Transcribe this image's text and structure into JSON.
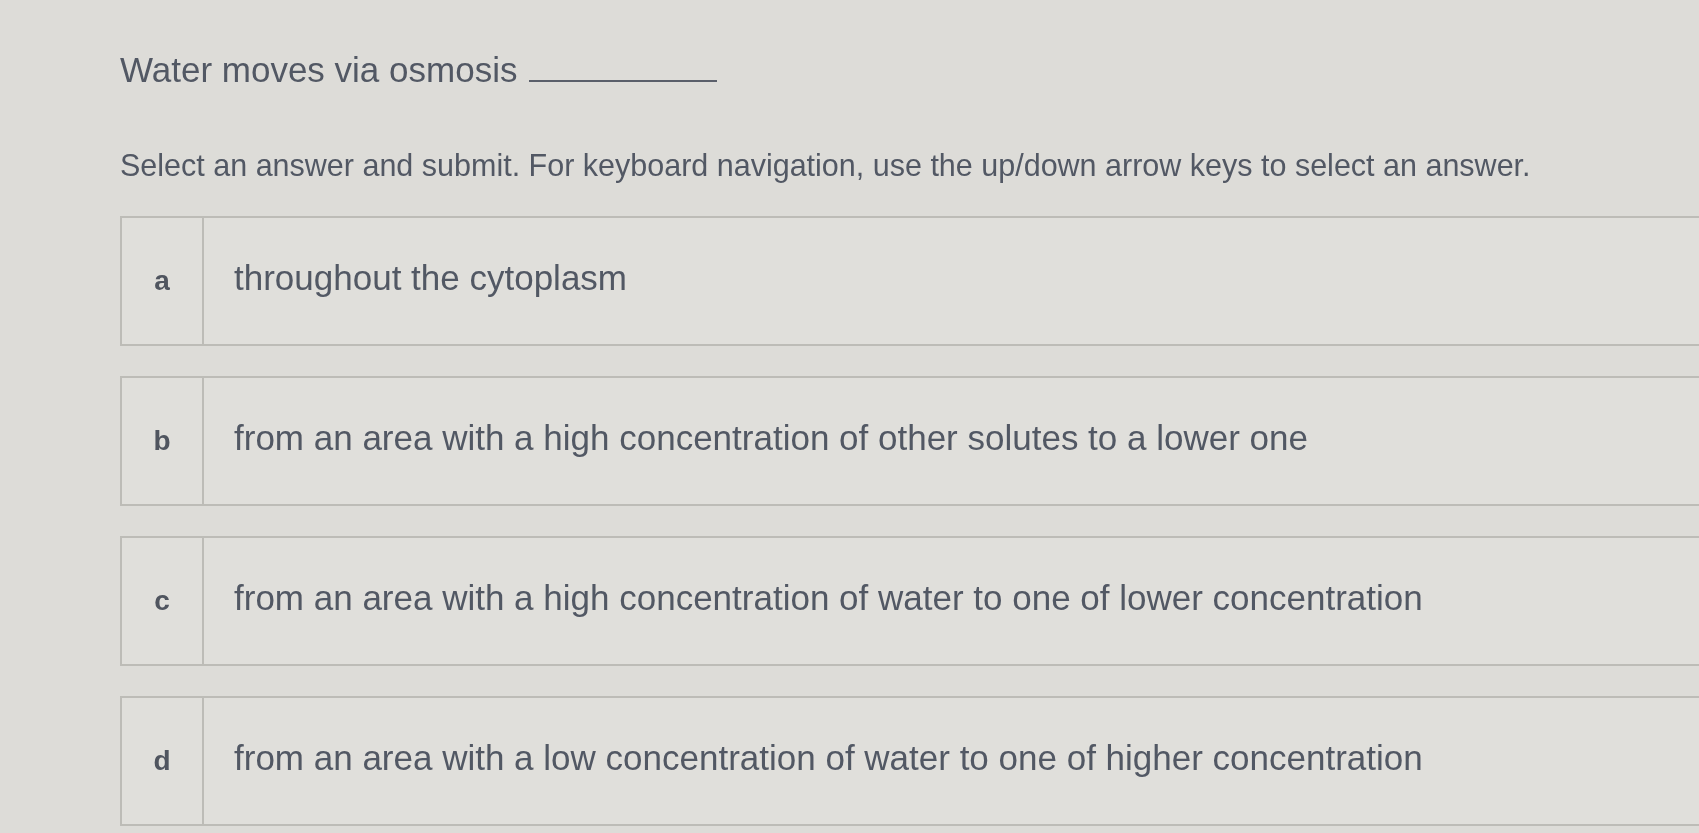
{
  "question": {
    "text": "Water moves via osmosis"
  },
  "instructions": "Select an answer and submit. For keyboard navigation, use the up/down arrow keys to select an answer.",
  "options": [
    {
      "letter": "a",
      "text": "throughout the cytoplasm",
      "selected": false
    },
    {
      "letter": "b",
      "text": "from an area with a high concentration of other solutes to a lower one",
      "selected": false
    },
    {
      "letter": "c",
      "text": "from an area with a high concentration of water to one of lower concentration",
      "selected": false
    },
    {
      "letter": "d",
      "text": "from an area with a low concentration of water to one of higher concentration",
      "selected": false
    }
  ]
}
